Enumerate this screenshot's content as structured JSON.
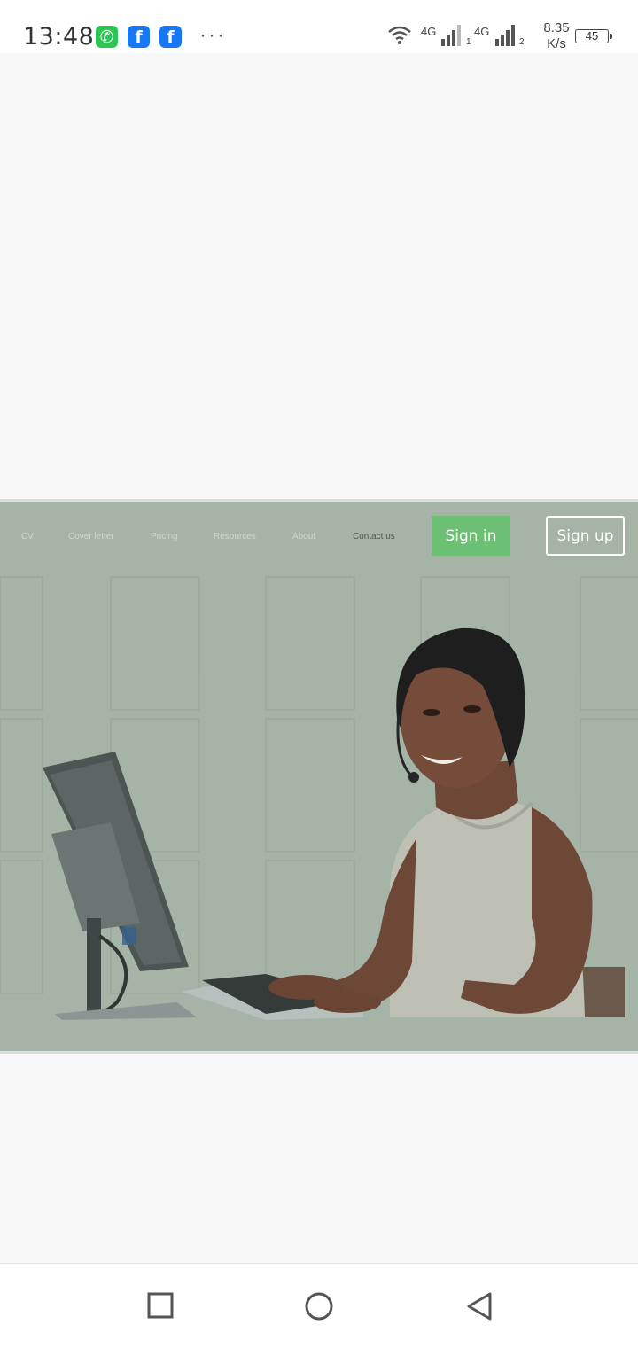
{
  "status_bar": {
    "time": "13:48",
    "apps": [
      {
        "icon": "whatsapp-icon",
        "glyph": "✆"
      },
      {
        "icon": "facebook-icon",
        "glyph": "f"
      },
      {
        "icon": "facebook-icon",
        "glyph": "f"
      }
    ],
    "more": "···",
    "network1": "4G",
    "network2": "4G",
    "sim1": "1",
    "sim2": "2",
    "speed_value": "8.35",
    "speed_unit": "K/s",
    "battery": "45"
  },
  "hero": {
    "nav_links": [
      "CV",
      "Cover letter",
      "Pricing",
      "Resources",
      "About",
      "Contact us"
    ],
    "sign_in": "Sign in",
    "sign_up": "Sign up",
    "colors": {
      "overlay": "#a6b3a7",
      "sign_in_bg": "#6cc074"
    }
  },
  "nav_bar": {
    "buttons": [
      "recent-apps-icon",
      "home-icon",
      "back-icon"
    ]
  }
}
